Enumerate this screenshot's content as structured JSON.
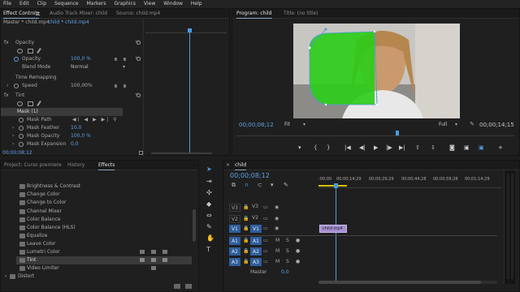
{
  "menu": [
    "File",
    "Edit",
    "Clip",
    "Sequence",
    "Markers",
    "Graphics",
    "View",
    "Window",
    "Help"
  ],
  "effect_controls": {
    "tabs": [
      "Effect Controls",
      "Audio Track Mixer: child",
      "Source: child.mp4"
    ],
    "master_label": "Master * child.mp4",
    "clip_label": "child * child.mp4",
    "rows": {
      "opacity_header": "Opacity",
      "opacity_label": "Opacity",
      "opacity_value": "100,0 %",
      "blend_label": "Blend Mode",
      "blend_value": "Normal",
      "time_remap": "Time Remapping",
      "speed_label": "Speed",
      "speed_value": "100,00%",
      "tint": "Tint",
      "mask": "Mask (1)",
      "mask_path": "Mask Path",
      "mask_feather_label": "Mask Feather",
      "mask_feather_value": "10,0",
      "mask_opacity_label": "Mask Opacity",
      "mask_opacity_value": "100,0 %",
      "mask_expansion_label": "Mask Expansion",
      "mask_expansion_value": "0,0"
    },
    "timecode": "00;00;08;12"
  },
  "program": {
    "tabs": [
      "Program: child",
      "Title: (no title)"
    ],
    "timecode": "00;00;08;12",
    "fit": "Fit",
    "quality": "Full",
    "duration": "00;00;14;15"
  },
  "project": {
    "tabs": [
      "Project: Curso premiere",
      "History",
      "Effects"
    ],
    "effects": [
      "Brightness & Contrast",
      "Change Color",
      "Change to Color",
      "Channel Mixer",
      "Color Balance",
      "Color Balance (HLS)",
      "Equalize",
      "Leave Color",
      "Lumetri Color",
      "Tint",
      "Video Limiter"
    ],
    "distort": "Distort"
  },
  "timeline": {
    "tab": "child",
    "timecode": "00;00;08;12",
    "ruler": [
      ":00;00",
      "00;00;14;29",
      "00;00;29;29",
      "00;00;44;28",
      "00;00;59;28",
      "00;01;14;29"
    ],
    "tracks_video": [
      "V3",
      "V2",
      "V1"
    ],
    "tracks_audio": [
      "A1",
      "A2",
      "A3"
    ],
    "v1_src": "V1",
    "a1_src": "A1",
    "master_label": "Master",
    "master_value": "0,0",
    "clip_label": "child.mp4",
    "track_letters": [
      "M",
      "S"
    ]
  },
  "colors": {
    "accent": "#4a90d9",
    "overlay_green": "#2ecc1a",
    "playhead": "#4a9be0",
    "clip": "#a58fd0"
  }
}
